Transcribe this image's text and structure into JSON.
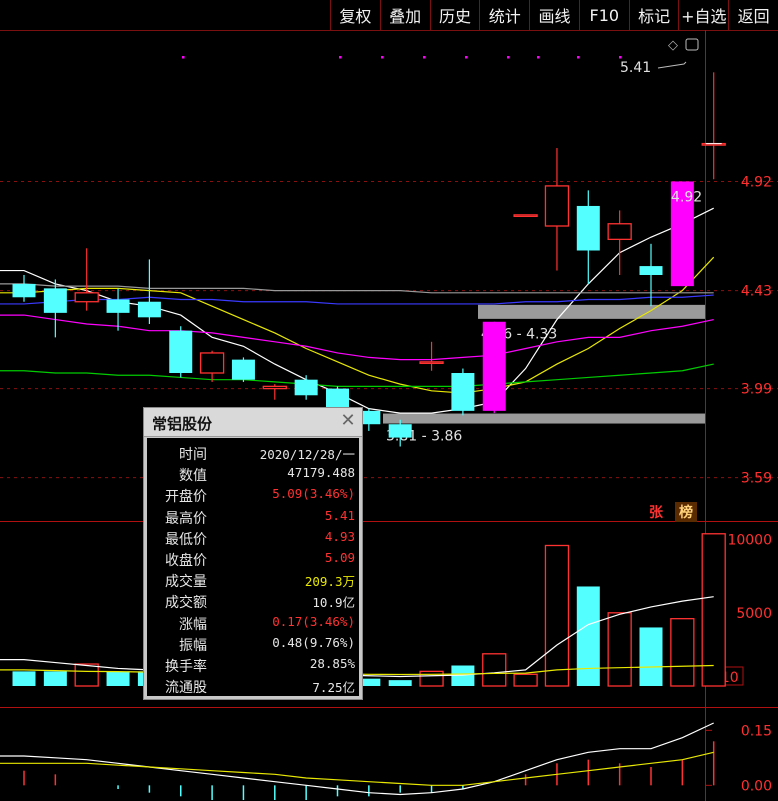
{
  "toolbar": {
    "items": [
      "复权",
      "叠加",
      "历史",
      "统计",
      "画线",
      "F10",
      "标记",
      "+自选",
      "返回"
    ]
  },
  "price_axis": {
    "labels": [
      "4.92",
      "4.43",
      "3.99",
      "3.59"
    ]
  },
  "volume_axis": {
    "labels": [
      "10000",
      "5000"
    ],
    "multiplier": "X10"
  },
  "indicator_axis": {
    "labels": [
      "0.15",
      "0.00"
    ]
  },
  "annotations": {
    "high_label": "5.41",
    "close_label": "4.92",
    "range_upper": "4.26 - 4.33",
    "range_lower": "3.81 - 3.86",
    "badge_zhang": "张",
    "badge_bang": "榜"
  },
  "colors": {
    "up": "#ff3232",
    "down": "#54ffff",
    "limit_up": "#ff00ff",
    "ma5": "#ffffff",
    "ma10": "#e8e800",
    "ma20": "#ff00ff",
    "ma30": "#00cc00",
    "ma60": "#3a3aff",
    "ma_long": "#999999"
  },
  "infobox": {
    "title": "常铝股份",
    "rows": [
      {
        "label": "时间",
        "value": "2020/12/28/一",
        "color": "wht"
      },
      {
        "label": "数值",
        "value": "47179.488",
        "color": "wht"
      },
      {
        "label": "开盘价",
        "value": "5.09(3.46%)",
        "color": "red"
      },
      {
        "label": "最高价",
        "value": "5.41",
        "color": "red"
      },
      {
        "label": "最低价",
        "value": "4.93",
        "color": "red"
      },
      {
        "label": "收盘价",
        "value": "5.09",
        "color": "red"
      },
      {
        "label": "成交量",
        "value": "209.3万",
        "color": "yel"
      },
      {
        "label": "成交额",
        "value": "10.9亿",
        "color": "wht"
      },
      {
        "label": "涨幅",
        "value": "0.17(3.46%)",
        "color": "red"
      },
      {
        "label": "振幅",
        "value": "0.48(9.76%)",
        "color": "wht"
      },
      {
        "label": "换手率",
        "value": "28.85%",
        "color": "wht"
      },
      {
        "label": "流通股",
        "value": "7.25亿",
        "color": "wht"
      }
    ]
  },
  "chart_data": {
    "type": "candlestick",
    "title": "",
    "price_range": [
      3.4,
      5.6
    ],
    "candles": [
      {
        "o": 4.46,
        "c": 4.4,
        "h": 4.5,
        "l": 4.38
      },
      {
        "o": 4.44,
        "c": 4.33,
        "h": 4.48,
        "l": 4.22
      },
      {
        "o": 4.38,
        "c": 4.42,
        "h": 4.62,
        "l": 4.34
      },
      {
        "o": 4.39,
        "c": 4.33,
        "h": 4.44,
        "l": 4.25
      },
      {
        "o": 4.38,
        "c": 4.31,
        "h": 4.57,
        "l": 4.28
      },
      {
        "o": 4.25,
        "c": 4.06,
        "h": 4.27,
        "l": 4.04
      },
      {
        "o": 4.06,
        "c": 4.15,
        "h": 4.16,
        "l": 4.02
      },
      {
        "o": 4.12,
        "c": 4.03,
        "h": 4.13,
        "l": 4.02
      },
      {
        "o": 3.99,
        "c": 4.0,
        "h": 4.01,
        "l": 3.94
      },
      {
        "o": 4.03,
        "c": 3.96,
        "h": 4.05,
        "l": 3.94
      },
      {
        "o": 3.99,
        "c": 3.84,
        "h": 4.0,
        "l": 3.82
      },
      {
        "o": 3.89,
        "c": 3.83,
        "h": 3.9,
        "l": 3.8
      },
      {
        "o": 3.83,
        "c": 3.77,
        "h": 3.85,
        "l": 3.73
      },
      {
        "o": 4.11,
        "c": 4.11,
        "h": 4.2,
        "l": 4.07
      },
      {
        "o": 4.06,
        "c": 3.89,
        "h": 4.08,
        "l": 3.87
      },
      {
        "o": 3.89,
        "c": 4.29,
        "h": 4.29,
        "l": 3.88,
        "limit": true
      },
      {
        "o": 4.77,
        "c": 4.77,
        "h": 4.77,
        "l": 4.77
      },
      {
        "o": 4.72,
        "c": 4.9,
        "h": 5.07,
        "l": 4.52
      },
      {
        "o": 4.81,
        "c": 4.61,
        "h": 4.88,
        "l": 4.46
      },
      {
        "o": 4.66,
        "c": 4.73,
        "h": 4.79,
        "l": 4.5
      },
      {
        "o": 4.54,
        "c": 4.5,
        "h": 4.64,
        "l": 4.36
      },
      {
        "o": 4.45,
        "c": 4.92,
        "h": 4.92,
        "l": 4.45,
        "limit": true
      },
      {
        "o": 5.09,
        "c": 5.09,
        "h": 5.41,
        "l": 4.93
      }
    ],
    "ma_lines": [
      {
        "name": "",
        "color": "ma5",
        "values": [
          4.52,
          4.46,
          4.43,
          4.38,
          4.36,
          4.32,
          4.22,
          4.18,
          4.1,
          4.03,
          3.97,
          3.9,
          3.88,
          3.88,
          3.9,
          3.93,
          4.08,
          4.3,
          4.46,
          4.6,
          4.67,
          4.73,
          4.8
        ]
      },
      {
        "name": "",
        "color": "ma10",
        "values": [
          4.42,
          4.43,
          4.44,
          4.44,
          4.43,
          4.42,
          4.36,
          4.3,
          4.24,
          4.17,
          4.11,
          4.05,
          4.01,
          3.98,
          3.97,
          3.99,
          4.02,
          4.1,
          4.17,
          4.26,
          4.34,
          4.43,
          4.58
        ]
      },
      {
        "name": "",
        "color": "ma20",
        "values": [
          4.32,
          4.3,
          4.28,
          4.27,
          4.25,
          4.25,
          4.24,
          4.22,
          4.2,
          4.18,
          4.15,
          4.13,
          4.12,
          4.12,
          4.13,
          4.14,
          4.17,
          4.2,
          4.22,
          4.22,
          4.25,
          4.27,
          4.3
        ]
      },
      {
        "name": "",
        "color": "ma30",
        "values": [
          4.07,
          4.06,
          4.06,
          4.05,
          4.05,
          4.04,
          4.03,
          4.03,
          4.02,
          4.01,
          4.0,
          4.0,
          4.0,
          4.0,
          4.0,
          4.01,
          4.02,
          4.03,
          4.04,
          4.05,
          4.06,
          4.07,
          4.1
        ]
      },
      {
        "name": "",
        "color": "ma60",
        "values": [
          4.37,
          4.38,
          4.39,
          4.39,
          4.4,
          4.39,
          4.39,
          4.38,
          4.38,
          4.38,
          4.37,
          4.37,
          4.37,
          4.37,
          4.37,
          4.37,
          4.38,
          4.38,
          4.39,
          4.39,
          4.4,
          4.4,
          4.41
        ]
      },
      {
        "name": "",
        "color": "ma_long",
        "values": [
          4.46,
          4.45,
          4.45,
          4.45,
          4.44,
          4.44,
          4.44,
          4.44,
          4.43,
          4.43,
          4.43,
          4.43,
          4.43,
          4.42,
          4.42,
          4.42,
          4.42,
          4.42,
          4.42,
          4.42,
          4.42,
          4.42,
          4.42
        ]
      }
    ],
    "volume": {
      "range": [
        0,
        11000
      ],
      "values": [
        1000,
        1000,
        1500,
        1000,
        1000,
        900,
        800,
        700,
        600,
        500,
        500,
        500,
        400,
        1000,
        1400,
        2200,
        800,
        9600,
        6800,
        5000,
        4000,
        4600,
        10400
      ],
      "ma": [
        1800,
        1600,
        1400,
        1200,
        1100,
        1000,
        950,
        900,
        850,
        800,
        750,
        700,
        650,
        700,
        750,
        900,
        1100,
        2800,
        4200,
        4900,
        5400,
        5800,
        6100
      ],
      "ma2": [
        1100,
        1050,
        1000,
        980,
        950,
        920,
        900,
        880,
        860,
        840,
        820,
        800,
        790,
        800,
        820,
        860,
        880,
        1100,
        1200,
        1250,
        1300,
        1350,
        1400
      ]
    },
    "indicator": {
      "range": [
        -0.04,
        0.2
      ],
      "bars": [
        0.04,
        0.03,
        0.0,
        -0.01,
        -0.02,
        -0.03,
        -0.04,
        -0.04,
        -0.04,
        -0.04,
        -0.03,
        -0.03,
        -0.02,
        -0.02,
        -0.01,
        0.0,
        0.03,
        0.06,
        0.07,
        0.06,
        0.05,
        0.07,
        0.12
      ],
      "line1": [
        0.08,
        0.075,
        0.07,
        0.06,
        0.05,
        0.04,
        0.03,
        0.02,
        0.01,
        0.0,
        -0.01,
        -0.02,
        -0.025,
        -0.02,
        -0.01,
        0.01,
        0.04,
        0.07,
        0.09,
        0.1,
        0.1,
        0.13,
        0.17
      ],
      "line2": [
        0.06,
        0.06,
        0.06,
        0.055,
        0.05,
        0.045,
        0.04,
        0.035,
        0.03,
        0.02,
        0.015,
        0.01,
        0.005,
        0.0,
        0.0,
        0.01,
        0.02,
        0.03,
        0.04,
        0.05,
        0.06,
        0.07,
        0.09
      ]
    }
  }
}
